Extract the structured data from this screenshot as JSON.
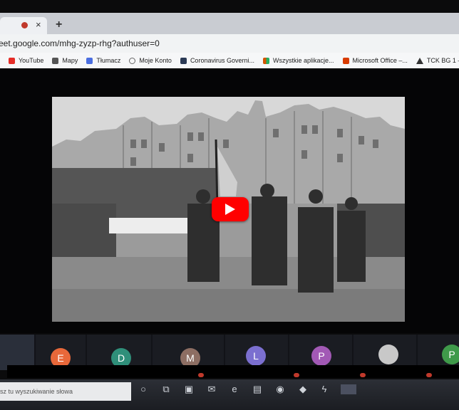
{
  "browser": {
    "tab_close": "×",
    "new_tab": "+",
    "url": "eet.google.com/mhg-zyzp-rhg?authuser=0"
  },
  "bookmarks": [
    {
      "label": "YouTube",
      "icon": "youtube-icon",
      "color": "#e52d27"
    },
    {
      "label": "Mapy",
      "icon": "maps-icon",
      "color": "#555555"
    },
    {
      "label": "Tłumacz",
      "icon": "translate-icon",
      "color": "#4a6ee0"
    },
    {
      "label": "Moje Konto",
      "icon": "account-icon",
      "color": "#666666"
    },
    {
      "label": "Coronavirus Governi...",
      "icon": "gov-icon",
      "color": "#2b3a55"
    },
    {
      "label": "Wszystkie aplikacje...",
      "icon": "apps-icon",
      "color": "#d35400"
    },
    {
      "label": "Microsoft Office –...",
      "icon": "office-icon",
      "color": "#d83b01"
    },
    {
      "label": "TCK BG 1 –",
      "icon": "warning-icon",
      "color": "#333333"
    }
  ],
  "video": {
    "play_icon": "youtube-play-icon",
    "play_color": "#ff0000"
  },
  "participants": [
    {
      "initial": "E",
      "color": "#e8683a"
    },
    {
      "initial": "D",
      "color": "#2f8f7a"
    },
    {
      "initial": "M",
      "color": "#8d6e63"
    },
    {
      "initial": "L",
      "color": "#7b6fd0"
    },
    {
      "initial": "P",
      "color": "#a259b5"
    },
    {
      "initial": "",
      "color": "#c8c8c8"
    },
    {
      "initial": "P",
      "color": "#3f9a4a"
    }
  ],
  "taskbar": {
    "search_placeholder": "isz tu wyszukiwanie słowa"
  }
}
